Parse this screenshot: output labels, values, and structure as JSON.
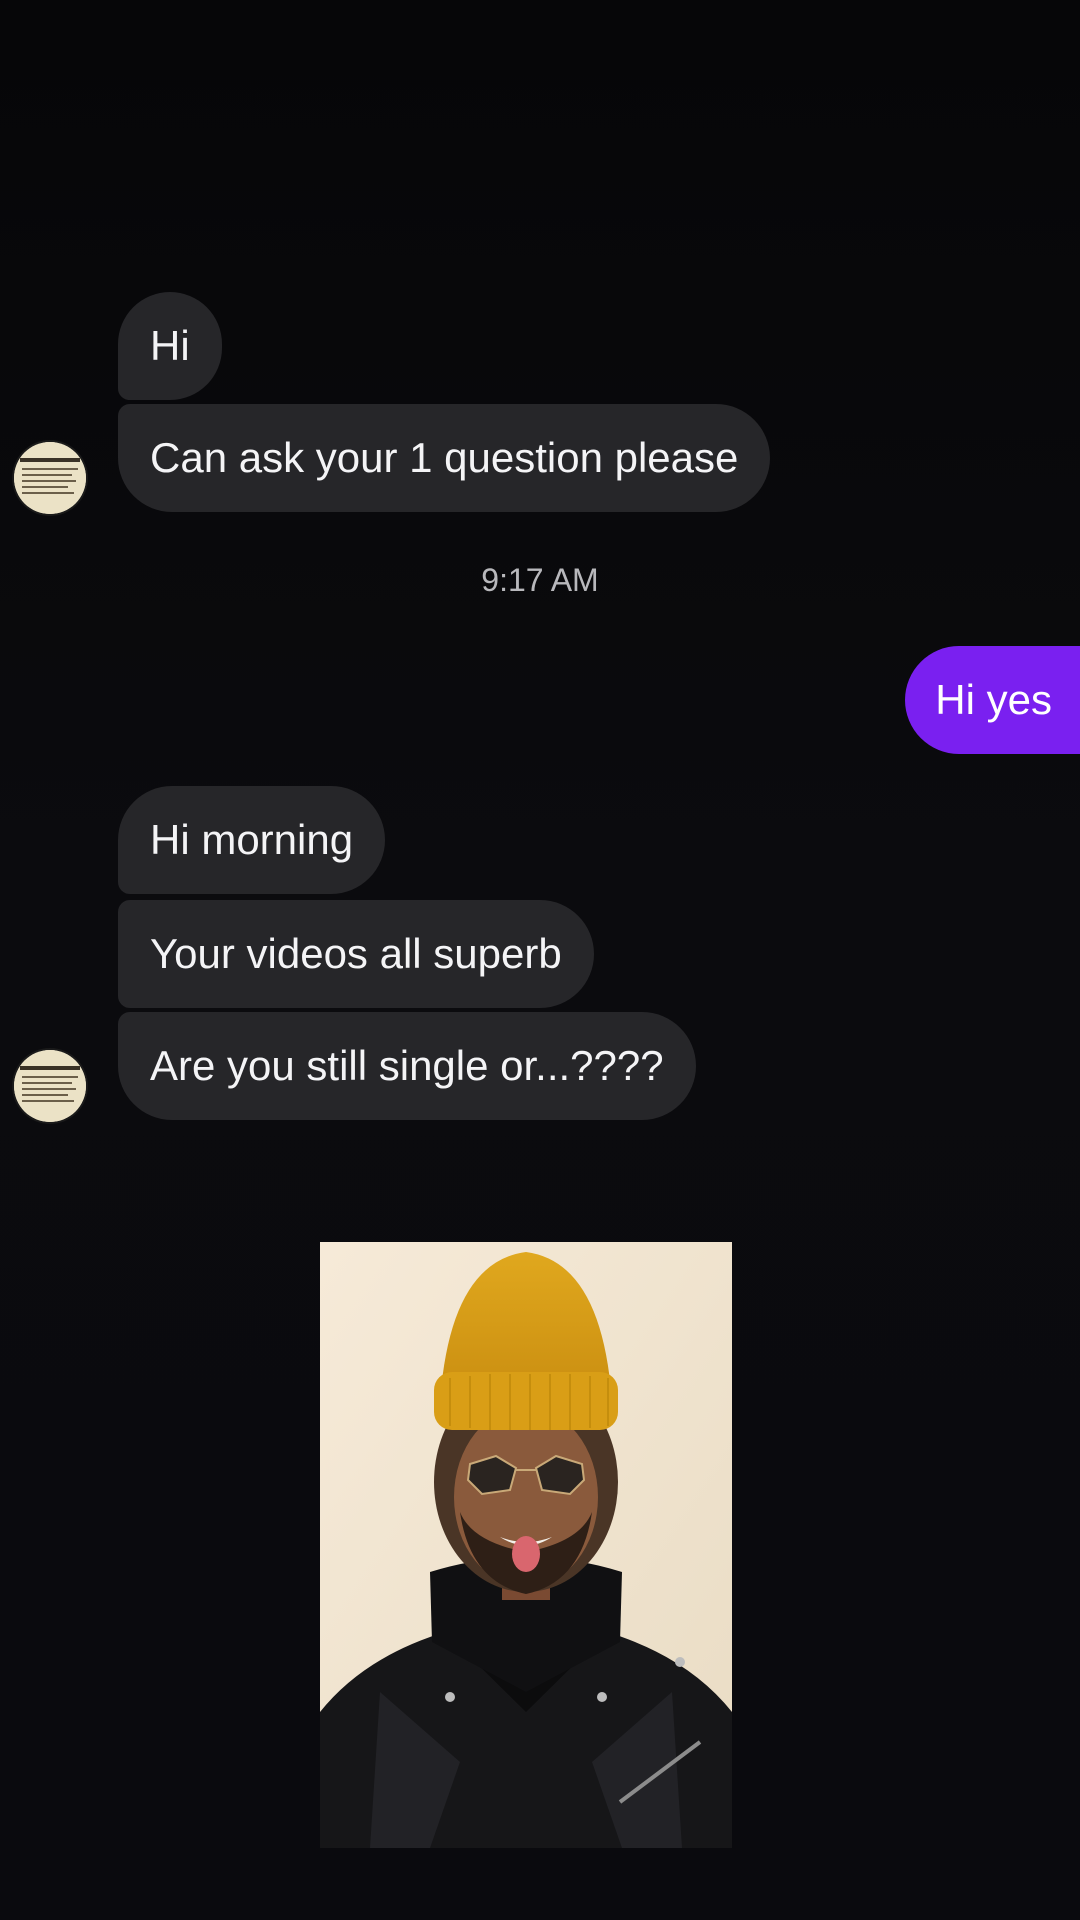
{
  "conversation": {
    "group1": {
      "messages": [
        "Hi",
        "Can ask your 1 question please"
      ],
      "avatar_icon": "newspaper-avatar-icon"
    },
    "timestamp": "9:17 AM",
    "outgoing": {
      "messages": [
        "Hi yes"
      ],
      "color": "#7a20f0"
    },
    "group2": {
      "messages": [
        "Hi morning",
        "Your videos all superb",
        "Are you still single or...????"
      ],
      "avatar_icon": "newspaper-avatar-icon"
    },
    "photo": {
      "icon": "portrait-photo"
    }
  },
  "colors": {
    "background": "#08080b",
    "incoming_bubble": "#262629",
    "outgoing_bubble": "#7a20f0",
    "timestamp_text": "#b8b8bc"
  }
}
